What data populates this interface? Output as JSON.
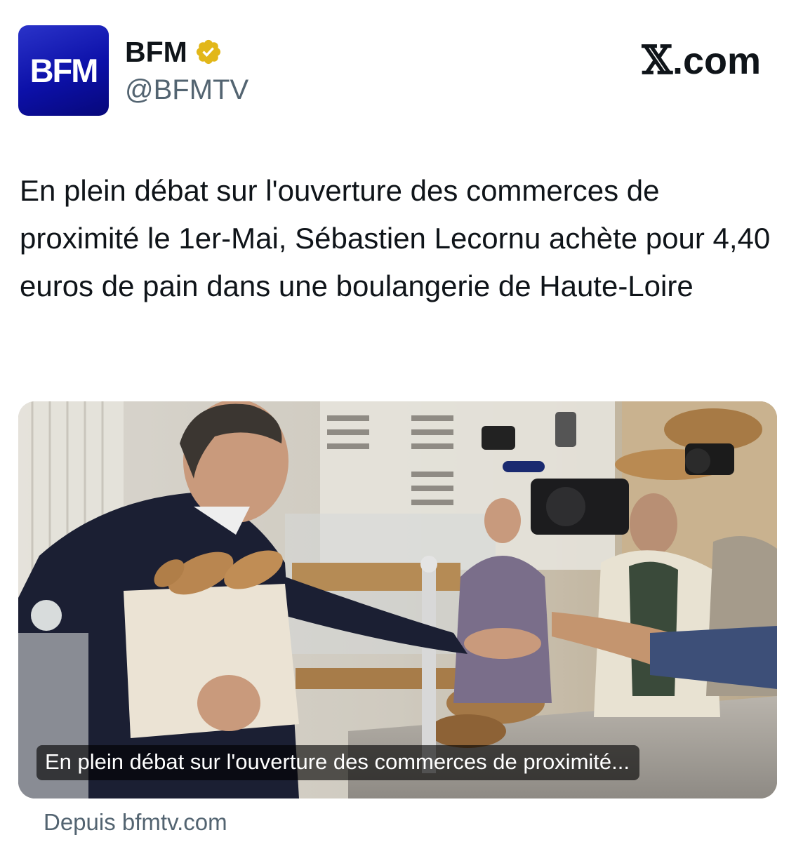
{
  "author": {
    "avatar_text": "BFM",
    "name": "BFM",
    "handle": "@BFMTV",
    "verified_badge": "verified-gold-icon"
  },
  "brand": {
    "x_symbol": "𝕏",
    "suffix": ".com"
  },
  "tweet": {
    "text": "En plein débat sur l'ouverture des commerces de proximité le 1er-Mai, Sébastien Lecornu achète pour 4,40 euros de pain dans une boulangerie de Haute-Loire"
  },
  "card": {
    "caption": "En plein débat sur l'ouverture des commerces de proximité...",
    "source": "Depuis bfmtv.com"
  },
  "colors": {
    "avatar_blue": "#1419b4",
    "badge_gold": "#e2b719",
    "muted_text": "#536471"
  }
}
